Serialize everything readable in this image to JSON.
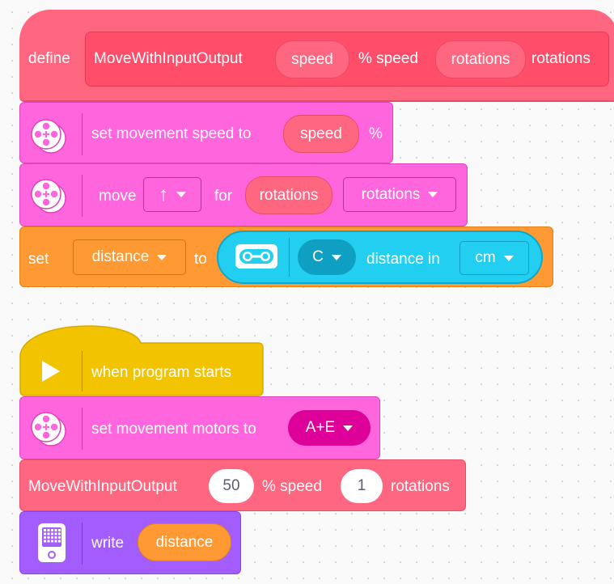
{
  "colors": {
    "define_block": "#ff6680",
    "define_inner": "#ff4d6a",
    "movement": "#ff66dd",
    "movement_dark": "#dd44bb",
    "variables": "#ff9933",
    "sensor": "#23cff0",
    "sensor_dark": "#0fa7c9",
    "events": "#f2c300",
    "display": "#a35dff",
    "port_pill": "#dd0099"
  },
  "define_block": {
    "keyword": "define",
    "name": "MoveWithInputOutput",
    "param1": "speed",
    "label1": "% speed",
    "param2": "rotations",
    "label2": "rotations"
  },
  "set_speed_block": {
    "icon": "movement-motor-icon",
    "label": "set movement speed to",
    "value": "speed",
    "suffix": "%"
  },
  "move_block": {
    "icon": "movement-motor-icon",
    "label": "move",
    "direction_glyph": "↑",
    "for_label": "for",
    "value": "rotations",
    "unit": "rotations"
  },
  "set_variable_block": {
    "keyword": "set",
    "variable": "distance",
    "to_label": "to",
    "sensor_icon": "distance-sensor-icon",
    "port": "C",
    "reporter_label": "distance in",
    "unit": "cm"
  },
  "start_hat_block": {
    "icon": "play-icon",
    "label": "when program starts"
  },
  "set_motors_block": {
    "icon": "movement-motor-icon",
    "label": "set movement motors to",
    "ports": "A+E"
  },
  "call_block": {
    "name": "MoveWithInputOutput",
    "arg1": "50",
    "label1": "% speed",
    "arg2": "1",
    "label2": "rotations"
  },
  "write_block": {
    "icon": "hub-display-icon",
    "label": "write",
    "value": "distance"
  }
}
